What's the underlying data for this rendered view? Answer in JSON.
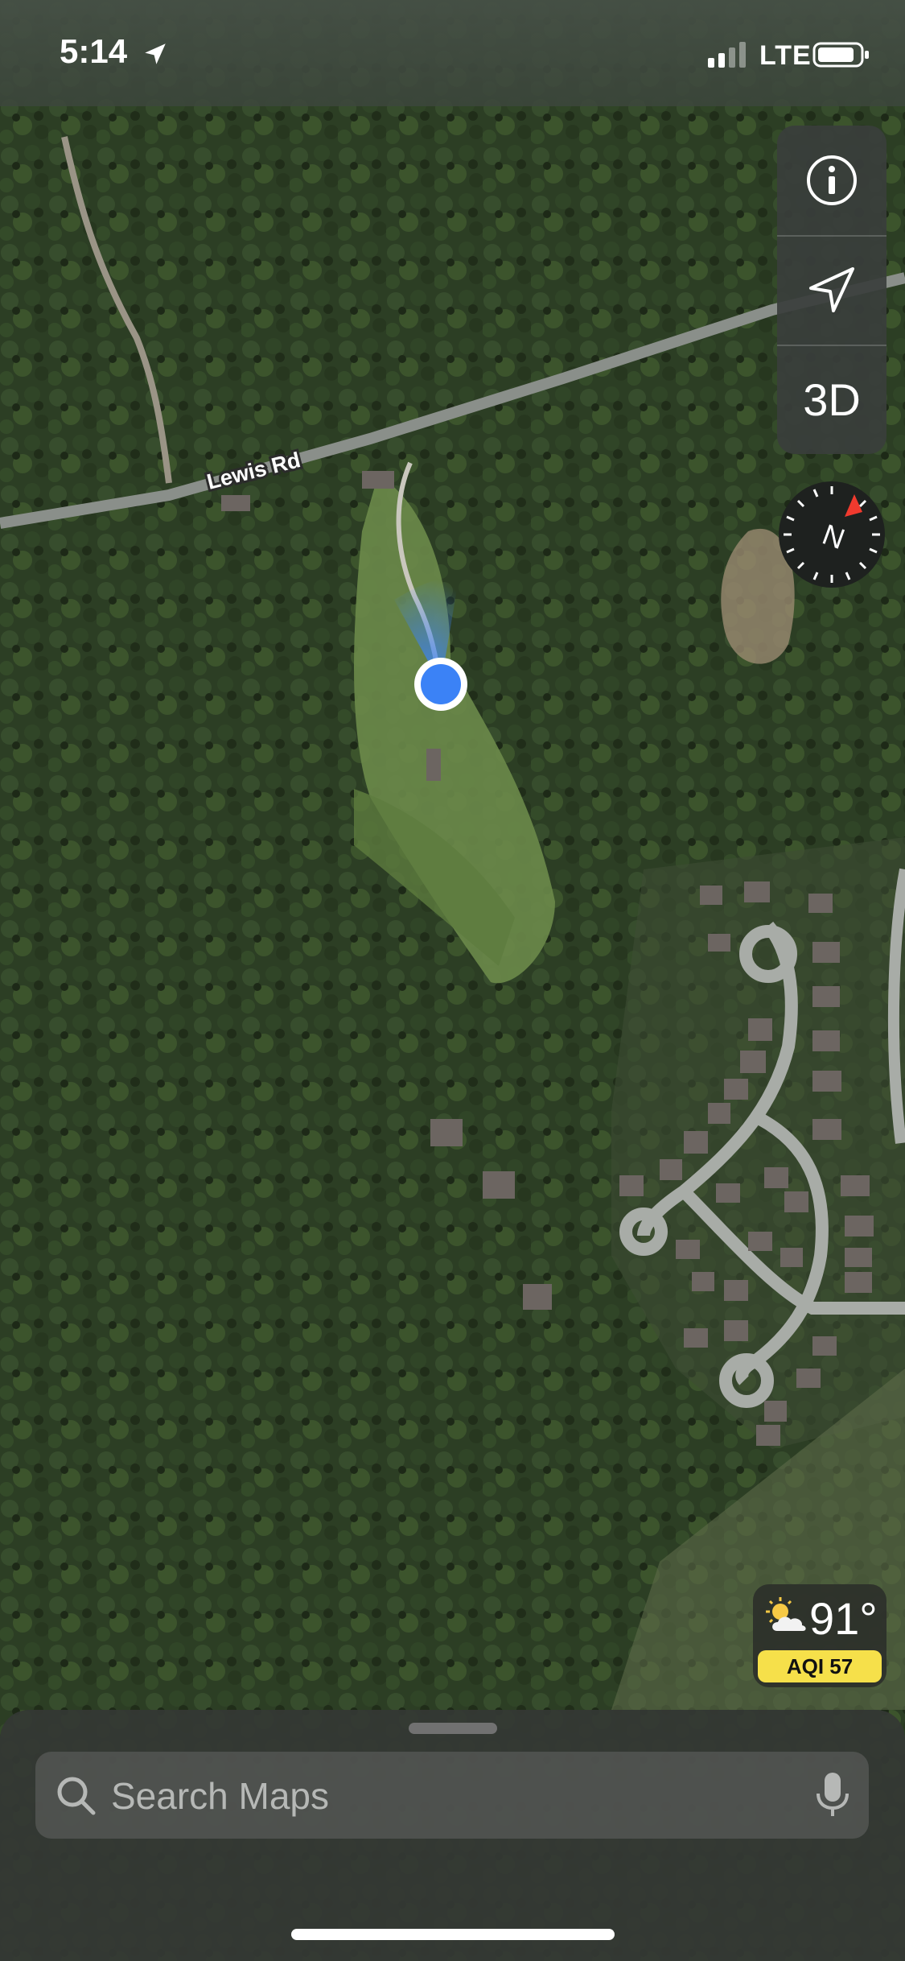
{
  "status_bar": {
    "time": "5:14",
    "carrier": "LTE",
    "location_icon": "location-arrow-icon",
    "signal_icon": "cellular-signal-icon",
    "battery_icon": "battery-icon"
  },
  "map": {
    "style": "satellite",
    "road_labels": [
      "Lewis Rd"
    ],
    "user_location_color": "#3b82f6"
  },
  "controls": {
    "info_icon": "info-icon",
    "track_icon": "location-arrow-icon",
    "three_d_label": "3D",
    "compass_label": "N",
    "compass_icon": "compass-icon"
  },
  "weather": {
    "temperature": "91°",
    "aqi": "AQI 57",
    "icon": "partly-sunny-icon",
    "aqi_color": "#f6e04a"
  },
  "search": {
    "placeholder": "Search Maps",
    "search_icon": "search-icon",
    "mic_icon": "microphone-icon"
  }
}
